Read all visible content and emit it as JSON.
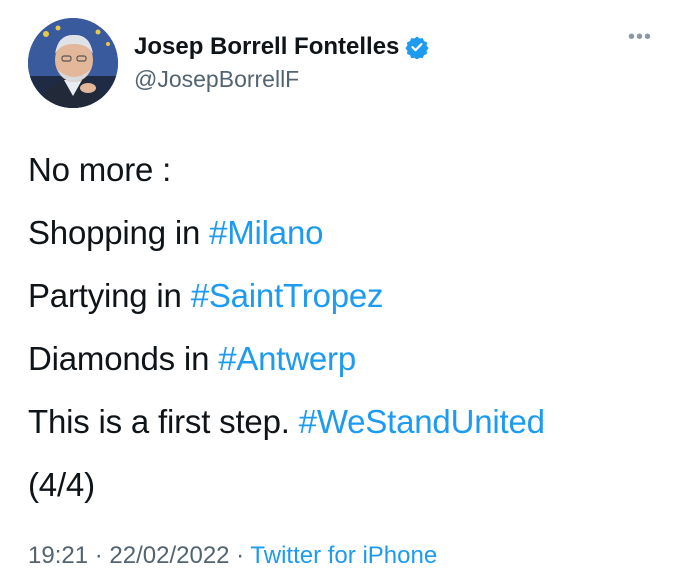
{
  "author": {
    "display_name": "Josep Borrell Fontelles",
    "handle": "@JosepBorrellF",
    "verified_icon": "verified-badge-icon",
    "avatar_icon": "profile-photo"
  },
  "menu": {
    "more_glyph": "•••"
  },
  "tweet": {
    "lines": [
      {
        "text": "No more :",
        "hashtag": ""
      },
      {
        "text": "Shopping in ",
        "hashtag": "#Milano"
      },
      {
        "text": "Partying in ",
        "hashtag": "#SaintTropez"
      },
      {
        "text": "Diamonds in ",
        "hashtag": "#Antwerp"
      },
      {
        "text": "This is a first step. ",
        "hashtag": "#WeStandUnited"
      },
      {
        "text": "(4/4)",
        "hashtag": ""
      }
    ]
  },
  "meta": {
    "time": "19:21",
    "sep1": " · ",
    "date": "22/02/2022",
    "sep2": " · ",
    "source": "Twitter for iPhone"
  },
  "colors": {
    "link": "#1d9bf0",
    "text": "#0f1419",
    "secondary": "#536471"
  }
}
